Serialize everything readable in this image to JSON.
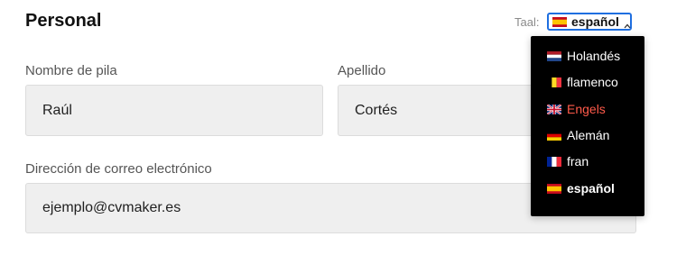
{
  "section": {
    "title": "Personal"
  },
  "language": {
    "label": "Taal:",
    "selected": "español",
    "selected_flag": "flag-es-icon",
    "options": [
      {
        "label": "Holandés",
        "flag": "flag-nl-icon"
      },
      {
        "label": "flamenco",
        "flag": "flag-be-icon"
      },
      {
        "label": "Engels",
        "flag": "flag-gb-icon",
        "state": "hover"
      },
      {
        "label": "Alemán",
        "flag": "flag-de-icon"
      },
      {
        "label": "fran",
        "flag": "flag-fr-icon"
      },
      {
        "label": "español",
        "flag": "flag-es-icon",
        "state": "selected"
      }
    ],
    "hover_color": "#ff5a4a",
    "focus_color": "#1f6fe0"
  },
  "form": {
    "first_name": {
      "label": "Nombre de pila",
      "value": "Raúl"
    },
    "last_name": {
      "label": "Apellido",
      "value": "Cortés"
    },
    "email": {
      "label": "Dirección de correo electrónico",
      "value": "ejemplo@cvmaker.es"
    }
  }
}
